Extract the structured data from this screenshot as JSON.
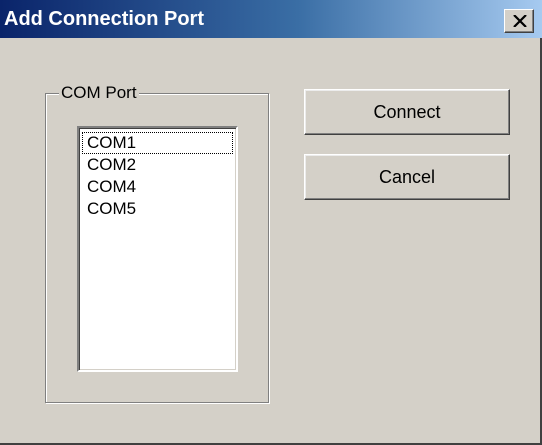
{
  "window": {
    "title": "Add Connection Port",
    "close_icon": "close-x-icon"
  },
  "group": {
    "label": "COM Port"
  },
  "port_list": {
    "items": [
      "COM1",
      "COM2",
      "COM4",
      "COM5"
    ],
    "focused_index": 0
  },
  "buttons": {
    "connect_label": "Connect",
    "cancel_label": "Cancel"
  },
  "colors": {
    "dialog_face": "#d4d0c8",
    "title_gradient_start": "#0a246a",
    "title_gradient_end": "#a6caf0",
    "title_text": "#ffffff"
  }
}
